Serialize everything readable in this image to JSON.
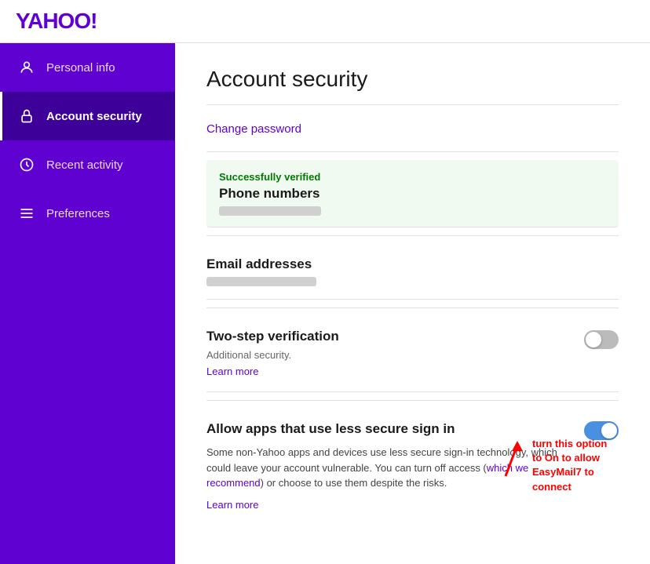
{
  "logo": "YAHOO!",
  "sidebar": {
    "items": [
      {
        "id": "personal-info",
        "label": "Personal info",
        "icon": "⚡",
        "active": false
      },
      {
        "id": "account-security",
        "label": "Account security",
        "icon": "🔒",
        "active": true
      },
      {
        "id": "recent-activity",
        "label": "Recent activity",
        "icon": "⏱",
        "active": false
      },
      {
        "id": "preferences",
        "label": "Preferences",
        "icon": "☰",
        "active": false
      }
    ]
  },
  "page": {
    "title": "Account security",
    "change_password": "Change password",
    "phone_verified_label": "Successfully verified",
    "phone_title": "Phone numbers",
    "email_title": "Email addresses",
    "two_step_title": "Two-step verification",
    "two_step_subtitle": "Additional security.",
    "two_step_learn_more": "Learn more",
    "two_step_toggle": "off",
    "allow_apps_title": "Allow apps that use less secure sign in",
    "allow_apps_desc_1": "Some non-Yahoo apps and devices use less secure sign-in technology, which could leave your account vulnerable. You can turn off access (which we recommend) or choose to use them despite the risks.",
    "allow_apps_learn_more": "Learn more",
    "allow_apps_toggle": "on",
    "annotation_text": "turn this option to On to allow EasyMail7 to connect"
  }
}
